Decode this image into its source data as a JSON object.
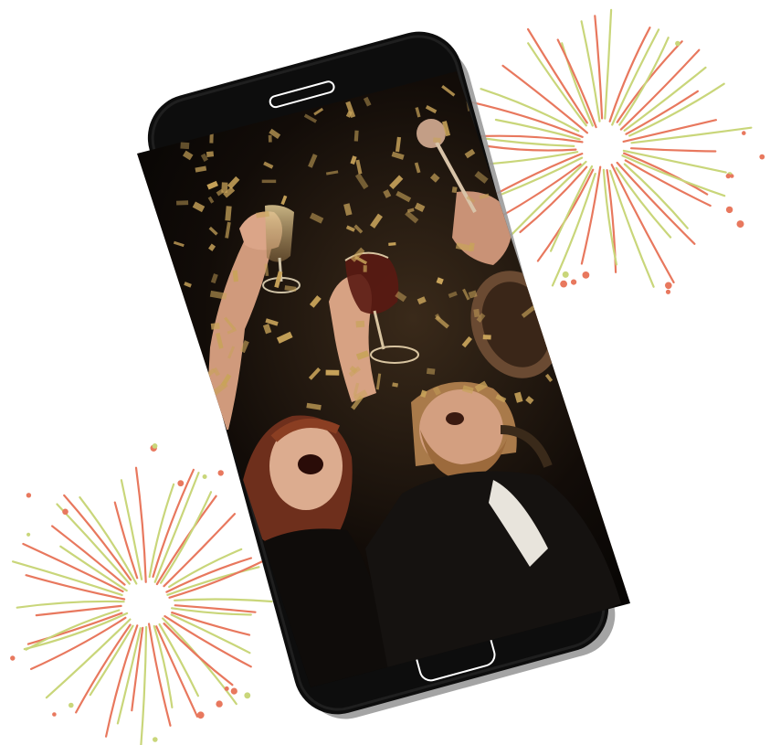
{
  "illustration": {
    "subject": "smartphone-celebration",
    "colors": {
      "phone_body": "#0d0d0d",
      "phone_edge": "#222222",
      "screen_bg": "#0a0806",
      "speaker_outline": "#ffffff",
      "home_button_outline": "#ffffff",
      "shadow": "#9a9a9a",
      "firework_red": "#e8785e",
      "firework_green": "#c9d67a",
      "confetti_gold": "#c8a35a",
      "skin": "#d9a68a",
      "hair_red": "#7a3a22",
      "hair_blond": "#b88a55"
    },
    "icons": {
      "speaker": "speaker-slot-icon",
      "home": "home-button-icon"
    }
  }
}
